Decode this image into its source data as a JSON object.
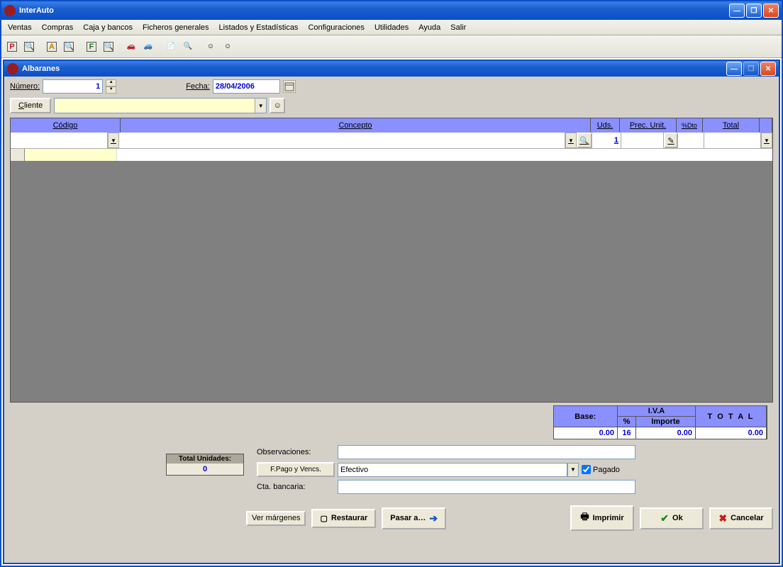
{
  "app": {
    "title": "InterAuto"
  },
  "menu": {
    "ventas": "Ventas",
    "compras": "Compras",
    "caja": "Caja y bancos",
    "ficheros": "Ficheros generales",
    "listados": "Listados y Estadísticas",
    "config": "Configuraciones",
    "utilidades": "Utilidades",
    "ayuda": "Ayuda",
    "salir": "Salir"
  },
  "child": {
    "title": "Albaranes"
  },
  "form": {
    "numero_label": "Número:",
    "numero_value": "1",
    "fecha_label": "Fecha:",
    "fecha_value": "28/04/2006",
    "cliente_button": "Cliente"
  },
  "grid": {
    "headers": {
      "codigo": "Código",
      "concepto": "Concepto",
      "uds": "Uds.",
      "punit": "Prec. Unit.",
      "dto": "%Dto",
      "total": "Total"
    },
    "row": {
      "uds": "1"
    }
  },
  "totals": {
    "base_label": "Base:",
    "iva_label": "I.V.A",
    "pct_label": "%",
    "importe_label": "Importe",
    "total_label": "T O T A L",
    "base_value": "0.00",
    "pct_value": "16",
    "importe_value": "0.00",
    "total_value": "0.00"
  },
  "footer": {
    "observ_label": "Observaciones:",
    "observ_value": "",
    "fpago_button": "F.Pago y Vencs.",
    "fpago_value": "Efectivo",
    "pagado_label": "Pagado",
    "cta_label": "Cta. bancaria:",
    "cta_value": "",
    "totunits_label": "Total Unidades:",
    "totunits_value": "0"
  },
  "buttons": {
    "ver": "Ver márgenes",
    "restaurar": "Restaurar",
    "pasar": "Pasar a…",
    "imprimir": "Imprimir",
    "ok": "Ok",
    "cancelar": "Cancelar"
  }
}
